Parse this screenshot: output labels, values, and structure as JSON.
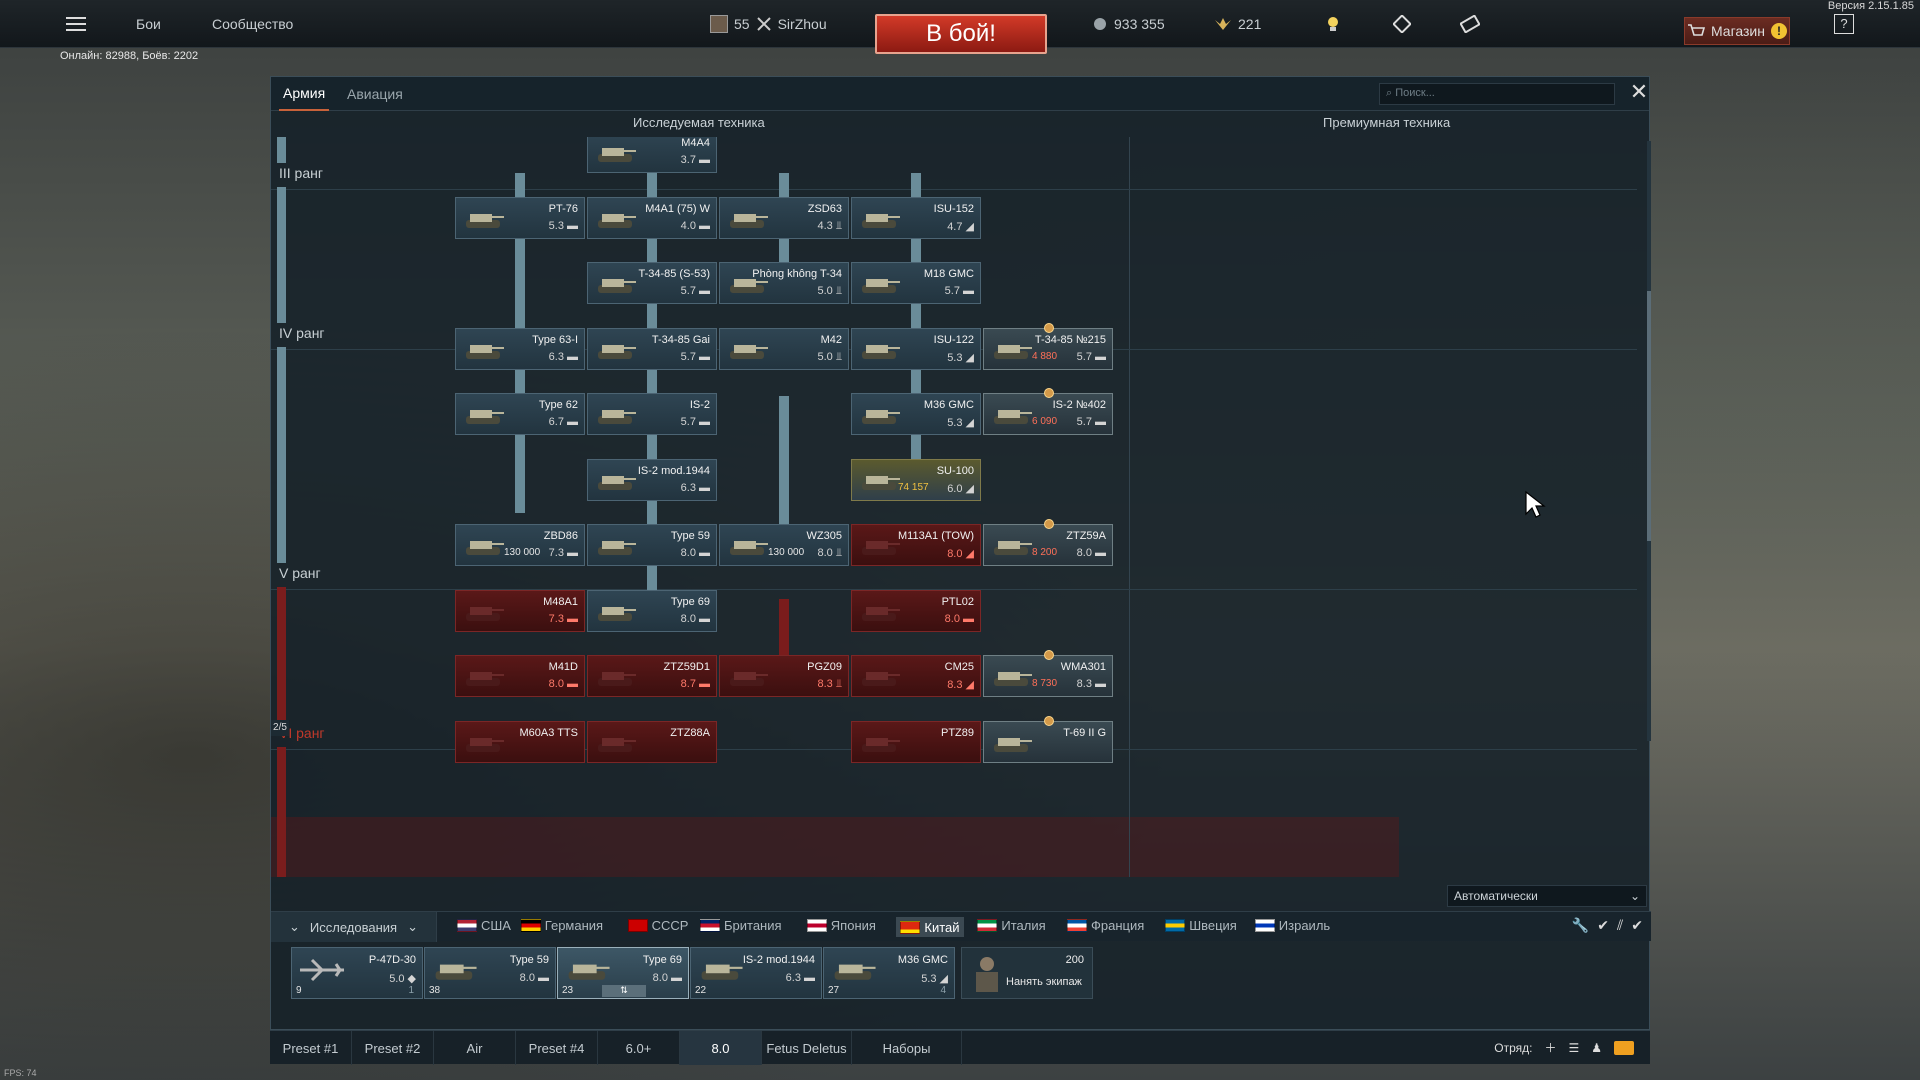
{
  "app": {
    "version": "Версия 2.15.1.85",
    "online": "Онлайн: 82988, Боёв: 2202",
    "fps": "FPS: 74"
  },
  "topbar": {
    "menu_icon": "hamburger-icon",
    "battles": "Бои",
    "community": "Сообщество",
    "level": "55",
    "player": "SirZhou",
    "battle_button": "В бой!",
    "silver": "933 355",
    "gold": "221",
    "shop": "Магазин",
    "help": "?"
  },
  "panel": {
    "tabs": [
      {
        "label": "Армия",
        "active": true
      },
      {
        "label": "Авиация",
        "active": false
      }
    ],
    "search_placeholder": "Поиск...",
    "col_researched": "Исследуемая техника",
    "col_premium": "Премиумная техника",
    "ranks": [
      "III ранг",
      "IV ранг",
      "V ранг",
      "VI ранг"
    ],
    "progress": "2/5",
    "auto_select": "Автоматически"
  },
  "tree": {
    "cards": [
      {
        "name": "M4A4",
        "br": "3.7 ▬",
        "col": 1,
        "row": 0
      },
      {
        "name": "PT-76",
        "br": "5.3 ▬",
        "col": 0,
        "row": 1
      },
      {
        "name": "M4A1 (75) W",
        "br": "4.0 ▬",
        "col": 1,
        "row": 1
      },
      {
        "name": "ZSD63",
        "br": "4.3 ⫫",
        "col": 2,
        "row": 1
      },
      {
        "name": "ISU-152",
        "br": "4.7 ◢",
        "col": 3,
        "row": 1
      },
      {
        "name": "T-34-85 (S-53)",
        "br": "5.7 ▬",
        "col": 1,
        "row": 2
      },
      {
        "name": "Phòng không T-34",
        "br": "5.0 ⫫",
        "col": 2,
        "row": 2
      },
      {
        "name": "M18 GMC",
        "br": "5.7 ▬",
        "col": 3,
        "row": 2
      },
      {
        "name": "Type 63-I",
        "br": "6.3 ▬",
        "col": 0,
        "row": 3
      },
      {
        "name": "T-34-85 Gai",
        "br": "5.7 ▬",
        "col": 1,
        "row": 3
      },
      {
        "name": "M42",
        "br": "5.0 ⫫",
        "col": 2,
        "row": 3
      },
      {
        "name": "ISU-122",
        "br": "5.3 ◢",
        "col": 3,
        "row": 3
      },
      {
        "name": "Type 62",
        "br": "6.7 ▬",
        "col": 0,
        "row": 4
      },
      {
        "name": "IS-2",
        "br": "5.7 ▬",
        "col": 1,
        "row": 4
      },
      {
        "name": "M36 GMC",
        "br": "5.3 ◢",
        "col": 3,
        "row": 4
      },
      {
        "name": "IS-2 mod.1944",
        "br": "6.3 ▬",
        "col": 1,
        "row": 5
      },
      {
        "name": "SU-100",
        "br": "6.0 ◢",
        "col": 3,
        "row": 5,
        "ycost": "74 157"
      },
      {
        "name": "ZBD86",
        "br": "7.3 ▬",
        "col": 0,
        "row": 6,
        "cost": "130 000"
      },
      {
        "name": "Type 59",
        "br": "8.0 ▬",
        "col": 1,
        "row": 6
      },
      {
        "name": "WZ305",
        "br": "8.0 ⫫",
        "col": 2,
        "row": 6,
        "cost": "130 000"
      },
      {
        "name": "M113A1 (TOW)",
        "br": "8.0 ◢",
        "col": 3,
        "row": 6,
        "locked": true
      },
      {
        "name": "M48A1",
        "br": "7.3 ▬",
        "col": 0,
        "row": 7,
        "locked": true
      },
      {
        "name": "Type 69",
        "br": "8.0 ▬",
        "col": 1,
        "row": 7
      },
      {
        "name": "PTL02",
        "br": "8.0 ▬",
        "col": 3,
        "row": 7,
        "locked": true
      },
      {
        "name": "M41D",
        "br": "8.0 ▬",
        "col": 0,
        "row": 8,
        "locked": true
      },
      {
        "name": "ZTZ59D1",
        "br": "8.7 ▬",
        "col": 1,
        "row": 8,
        "locked": true
      },
      {
        "name": "PGZ09",
        "br": "8.3 ⫫",
        "col": 2,
        "row": 8,
        "locked": true
      },
      {
        "name": "CM25",
        "br": "8.3 ◢",
        "col": 3,
        "row": 8,
        "locked": true
      },
      {
        "name": "M60A3 TTS",
        "br": "",
        "col": 0,
        "row": 9,
        "locked": true
      },
      {
        "name": "ZTZ88A",
        "br": "",
        "col": 1,
        "row": 9,
        "locked": true
      },
      {
        "name": "PTZ89",
        "br": "",
        "col": 3,
        "row": 9,
        "locked": true
      }
    ],
    "premium": [
      {
        "name": "T-34-85 №215",
        "cost": "4 880",
        "br": "5.7 ▬",
        "row": 3
      },
      {
        "name": "IS-2 №402",
        "cost": "6 090",
        "br": "5.7 ▬",
        "row": 4
      },
      {
        "name": "ZTZ59A",
        "cost": "8 200",
        "br": "8.0 ▬",
        "row": 6
      },
      {
        "name": "WMA301",
        "cost": "8 730",
        "br": "8.3 ▬",
        "row": 8
      },
      {
        "name": "T-69 II G",
        "cost": "",
        "br": "",
        "row": 9
      }
    ]
  },
  "nations_bar": {
    "research_button": "Исследования",
    "nations": [
      {
        "label": "США",
        "colors": [
          "#b22234",
          "#ffffff",
          "#3c3b6e"
        ]
      },
      {
        "label": "Германия",
        "colors": [
          "#000000",
          "#dd0000",
          "#ffce00"
        ]
      },
      {
        "label": "СССР",
        "colors": [
          "#cc0000",
          "#cc0000",
          "#cc0000"
        ]
      },
      {
        "label": "Британия",
        "colors": [
          "#012169",
          "#c8102e",
          "#ffffff"
        ]
      },
      {
        "label": "Япония",
        "colors": [
          "#ffffff",
          "#bc002d",
          "#ffffff"
        ]
      },
      {
        "label": "Китай",
        "colors": [
          "#de2910",
          "#de2910",
          "#ffde00"
        ],
        "active": true
      },
      {
        "label": "Италия",
        "colors": [
          "#009246",
          "#ffffff",
          "#ce2b37"
        ]
      },
      {
        "label": "Франция",
        "colors": [
          "#0055a4",
          "#ffffff",
          "#ef4135"
        ]
      },
      {
        "label": "Швеция",
        "colors": [
          "#006aa7",
          "#fecc00",
          "#006aa7"
        ]
      },
      {
        "label": "Израиль",
        "colors": [
          "#ffffff",
          "#0038b8",
          "#ffffff"
        ]
      }
    ]
  },
  "crew_slots": [
    {
      "name": "P-47D-30",
      "br": "5.0 ◆",
      "crew": "9",
      "count": "1",
      "type": "plane"
    },
    {
      "name": "Type 59",
      "br": "8.0 ▬",
      "crew": "38",
      "count": ""
    },
    {
      "name": "Type 69",
      "br": "8.0 ▬",
      "crew": "23",
      "count": "",
      "selected": true
    },
    {
      "name": "IS-2 mod.1944",
      "br": "6.3 ▬",
      "crew": "22",
      "count": ""
    },
    {
      "name": "M36 GMC",
      "br": "5.3 ◢",
      "crew": "27",
      "count": "4"
    }
  ],
  "hire": {
    "cost": "200",
    "label": "Нанять экипаж"
  },
  "bottombar": {
    "presets": [
      "Preset #1",
      "Preset #2",
      "Air",
      "Preset #4",
      "6.0+",
      "8.0",
      "Fetus Deletus",
      "Наборы"
    ],
    "active_preset": "8.0",
    "squad": "Отряд:"
  }
}
